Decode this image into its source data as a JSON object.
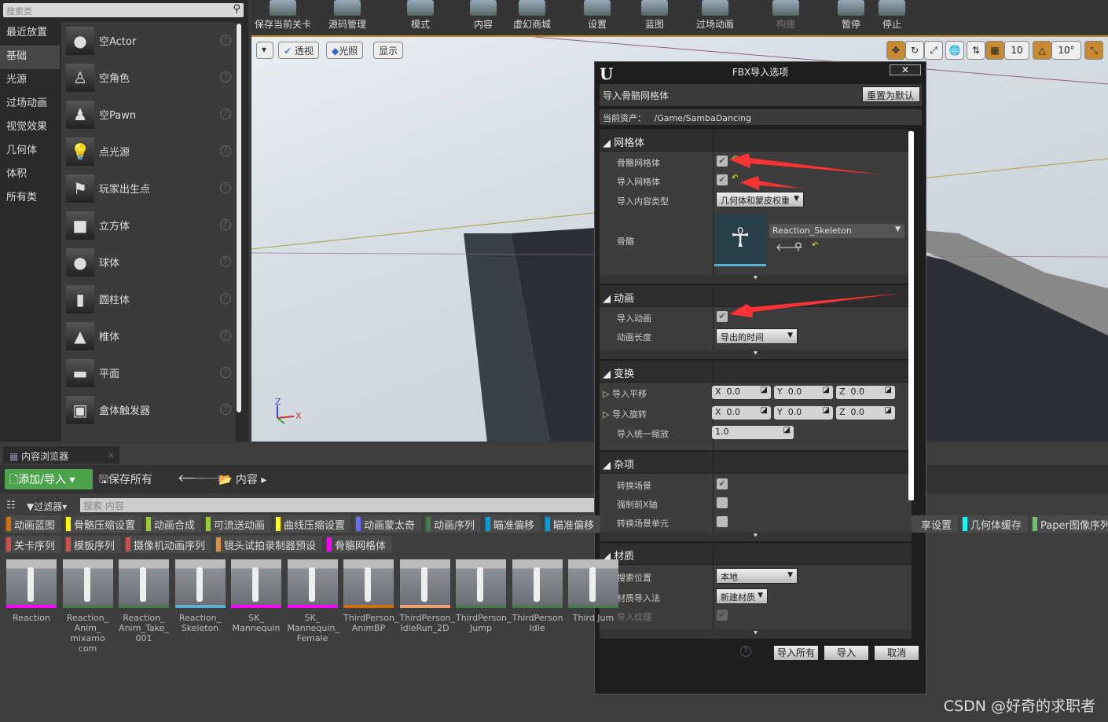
{
  "left_panel": {
    "search_placeholder": "搜索类",
    "categories": [
      "最近放置",
      "基础",
      "光源",
      "过场动画",
      "视觉效果",
      "几何体",
      "体积",
      "所有类"
    ],
    "items": [
      {
        "label": "空Actor",
        "icon": "sphere-icon"
      },
      {
        "label": "空角色",
        "icon": "character-icon"
      },
      {
        "label": "空Pawn",
        "icon": "pawn-icon"
      },
      {
        "label": "点光源",
        "icon": "lightbulb-icon"
      },
      {
        "label": "玩家出生点",
        "icon": "player-start-icon"
      },
      {
        "label": "立方体",
        "icon": "cube-icon"
      },
      {
        "label": "球体",
        "icon": "sphere-icon"
      },
      {
        "label": "圆柱体",
        "icon": "cylinder-icon"
      },
      {
        "label": "椎体",
        "icon": "cone-icon"
      },
      {
        "label": "平面",
        "icon": "plane-icon"
      },
      {
        "label": "盒体触发器",
        "icon": "box-trigger-icon"
      }
    ]
  },
  "toolbar": {
    "buttons": [
      "保存当前关卡",
      "源码管理",
      "模式",
      "内容",
      "虚幻商城",
      "设置",
      "蓝图",
      "过场动画",
      "构建",
      "暂停",
      "停止"
    ]
  },
  "viewport": {
    "perspective": "透视",
    "lighting": "光照",
    "show": "显示",
    "grid_snap": "10",
    "rotation_snap": "10°",
    "axis_x": "X",
    "axis_z": "Z"
  },
  "content_browser": {
    "tab": "内容浏览器",
    "add_import": "添加/导入",
    "save_all": "保存所有",
    "path": "内容",
    "filters": "过滤器",
    "search_placeholder": "搜索 内容",
    "tags_row1": [
      {
        "label": "动画蓝图",
        "color": "#d07010"
      },
      {
        "label": "骨骼压缩设置",
        "color": "#ffff00"
      },
      {
        "label": "动画合成",
        "color": "#9acd32"
      },
      {
        "label": "可流送动画",
        "color": "#9acd32"
      },
      {
        "label": "曲线压缩设置",
        "color": "#ffff00"
      },
      {
        "label": "动画蒙太奇",
        "color": "#6a6aff"
      },
      {
        "label": "动画序列",
        "color": "#4a7a4a"
      },
      {
        "label": "瞄准偏移",
        "color": "#00a0e0"
      },
      {
        "label": "瞄准偏移",
        "color": "#00a0e0"
      }
    ],
    "tags_row1_right": [
      {
        "label": "享设置",
        "color": "#4a4a4a"
      },
      {
        "label": "几何体缓存",
        "color": "#00ffff"
      },
      {
        "label": "Paper图像序列",
        "color": "#70c070"
      }
    ],
    "tags_row2": [
      {
        "label": "关卡序列",
        "color": "#d05050"
      },
      {
        "label": "模板序列",
        "color": "#d05050"
      },
      {
        "label": "摄像机动画序列",
        "color": "#d05050"
      },
      {
        "label": "镜头试拍录制器预设",
        "color": "#e09040"
      },
      {
        "label": "骨骼网格体",
        "color": "#ff00ff"
      }
    ],
    "assets": [
      {
        "name": "Reaction",
        "color": "#ff00ff"
      },
      {
        "name": "Reaction_ Anim_ mixamo com",
        "color": "#4a7a4a"
      },
      {
        "name": "Reaction_ Anim_Take_ 001",
        "color": "#4a7a4a"
      },
      {
        "name": "Reaction_ Skeleton",
        "color": "#5ab0d0"
      },
      {
        "name": "SK_ Mannequin",
        "color": "#ff00ff"
      },
      {
        "name": "SK_ Mannequin_ Female",
        "color": "#ff00ff"
      },
      {
        "name": "ThirdPerson_ AnimBP",
        "color": "#d07010"
      },
      {
        "name": "ThirdPerson_ IdleRun_2D",
        "color": "#f0a070"
      },
      {
        "name": "ThirdPerson_ Jump",
        "color": "#4a7a4a"
      },
      {
        "name": "ThirdPerson Idle",
        "color": "#4a7a4a"
      },
      {
        "name": "Third Jum",
        "color": "#4a7a4a"
      }
    ]
  },
  "dialog": {
    "title": "FBX导入选项",
    "header": "导入骨骼网格体",
    "reset": "重置为默认",
    "current_asset_label": "当前资产：",
    "current_asset": "/Game/SambaDancing",
    "mesh": {
      "title": "网格体",
      "skeletal_mesh": "骨骼网格体",
      "skeletal_mesh_checked": true,
      "import_mesh": "导入网格体",
      "import_mesh_checked": true,
      "content_type_label": "导入内容类型",
      "content_type": "几何体和蒙皮权重",
      "skeleton_label": "骨骼",
      "skeleton": "Reaction_Skeleton"
    },
    "animation": {
      "title": "动画",
      "import_anim": "导入动画",
      "import_anim_checked": true,
      "length_label": "动画长度",
      "length": "导出的时间"
    },
    "transform": {
      "title": "变换",
      "translation": "导入平移",
      "rotation": "导入旋转",
      "scale": "导入统一缩放",
      "tx": "0.0",
      "ty": "0.0",
      "tz": "0.0",
      "rx": "0.0",
      "ry": "0.0",
      "rz": "0.0",
      "scale_value": "1.0",
      "x": "X",
      "y": "Y",
      "z": "Z"
    },
    "misc": {
      "title": "杂项",
      "convert_scene": "转换场景",
      "convert_scene_checked": true,
      "force_front_x": "强制前X轴",
      "force_front_x_checked": false,
      "convert_scene_unit": "转换场景单元",
      "convert_scene_unit_checked": false
    },
    "material": {
      "title": "材质",
      "search_location_label": "搜索位置",
      "search_location": "本地",
      "import_method_label": "材质导入法",
      "import_method": "新建材质",
      "import_textures": "导入纹理",
      "import_textures_checked": true
    },
    "import_all": "导入所有",
    "import": "导入",
    "cancel": "取消"
  },
  "watermark": "CSDN @好奇的求职者",
  "annotation_color": "#ff3333"
}
